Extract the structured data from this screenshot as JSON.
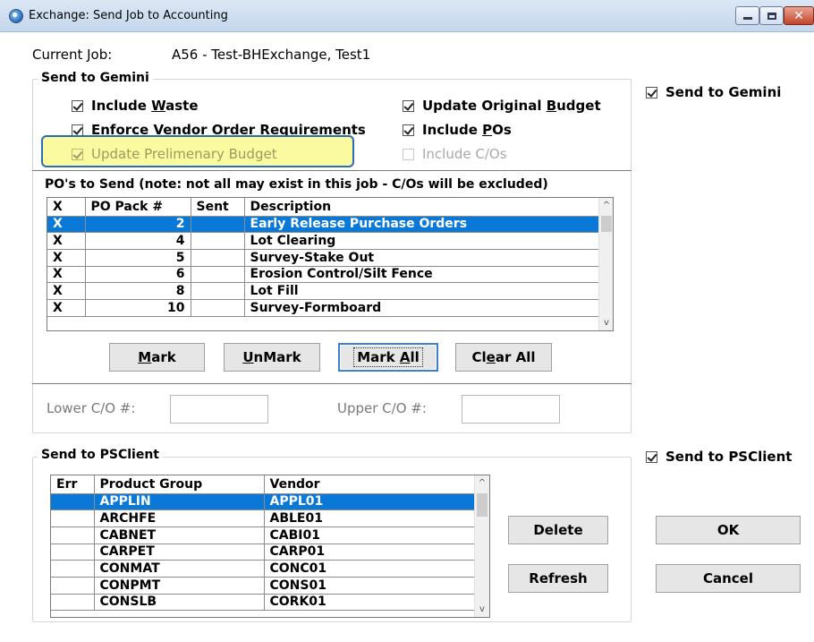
{
  "window": {
    "title": "Exchange: Send Job to Accounting"
  },
  "current_job": {
    "label": "Current Job:",
    "value": "A56 - Test-BHExchange, Test1"
  },
  "gemini_group": {
    "title": "Send to Gemini",
    "include_waste": {
      "pre": "Include ",
      "u": "W",
      "post": "aste",
      "checked": true
    },
    "enforce_vendor": {
      "pre": "",
      "u": "E",
      "post": "nforce Vendor Order Requirements",
      "checked": true
    },
    "update_prelim": {
      "label": "Update Prelimenary Budget",
      "checked": true
    },
    "update_original": {
      "pre": "Update Original ",
      "u": "B",
      "post": "udget",
      "checked": true
    },
    "include_pos": {
      "pre": "Include ",
      "u": "P",
      "post": "Os",
      "checked": true
    },
    "include_cos": {
      "label": "Include C/Os",
      "checked": false,
      "disabled": true
    }
  },
  "send_to_gemini_checkbox": {
    "label": "Send to Gemini",
    "checked": true
  },
  "pos_section": {
    "caption": "PO's to Send (note: not all may exist in this job - C/Os will be excluded)",
    "columns": [
      "X",
      "PO Pack #",
      "Sent",
      "Description"
    ],
    "rows": [
      {
        "x": "X",
        "pack": "2",
        "sent": "",
        "desc": "Early Release Purchase Orders",
        "selected": true
      },
      {
        "x": "X",
        "pack": "4",
        "sent": "",
        "desc": "Lot Clearing"
      },
      {
        "x": "X",
        "pack": "5",
        "sent": "",
        "desc": "Survey-Stake Out"
      },
      {
        "x": "X",
        "pack": "6",
        "sent": "",
        "desc": "Erosion Control/Silt Fence"
      },
      {
        "x": "X",
        "pack": "8",
        "sent": "",
        "desc": "Lot Fill"
      },
      {
        "x": "X",
        "pack": "10",
        "sent": "",
        "desc": "Survey-Formboard"
      }
    ]
  },
  "po_buttons": {
    "mark": {
      "u": "M",
      "post": "ark"
    },
    "unmark": {
      "u": "U",
      "post": "nMark"
    },
    "mark_all": {
      "pre": "Mark ",
      "u": "A",
      "post": "ll"
    },
    "clear_all": {
      "pre": "Cl",
      "u": "e",
      "post": "ar All"
    }
  },
  "co_range": {
    "lower_label": "Lower C/O #:",
    "lower_value": "",
    "upper_label": "Upper C/O #:",
    "upper_value": ""
  },
  "psclient_group": {
    "title": "Send to PSClient",
    "columns": [
      "Err",
      "Product Group",
      "Vendor"
    ],
    "rows": [
      {
        "err": "",
        "group": "APPLIN",
        "vendor": "APPL01",
        "selected": true
      },
      {
        "err": "",
        "group": "ARCHFE",
        "vendor": "ABLE01"
      },
      {
        "err": "",
        "group": "CABNET",
        "vendor": "CABI01"
      },
      {
        "err": "",
        "group": "CARPET",
        "vendor": "CARP01"
      },
      {
        "err": "",
        "group": "CONMAT",
        "vendor": "CONC01"
      },
      {
        "err": "",
        "group": "CONPMT",
        "vendor": "CONS01"
      },
      {
        "err": "",
        "group": "CONSLB",
        "vendor": "CORK01"
      }
    ],
    "delete_label": "Delete",
    "refresh_label": "Refresh"
  },
  "send_to_psclient_checkbox": {
    "label": "Send to PSClient",
    "checked": true
  },
  "dialog_buttons": {
    "ok": "OK",
    "cancel": "Cancel"
  },
  "colors": {
    "selection": "#0a78d7",
    "highlight_fill": "#fafaa0",
    "highlight_border": "#2a6db0"
  }
}
